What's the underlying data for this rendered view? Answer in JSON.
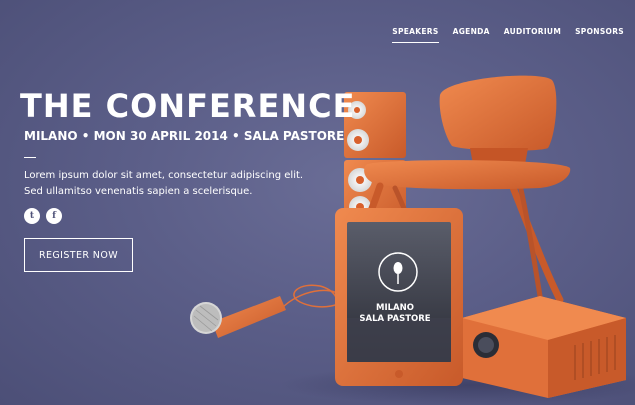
{
  "nav": {
    "items": [
      {
        "label": "SPEAKERS",
        "active": true
      },
      {
        "label": "AGENDA",
        "active": false
      },
      {
        "label": "AUDITORIUM",
        "active": false
      },
      {
        "label": "SPONSORS",
        "active": false
      }
    ]
  },
  "hero": {
    "title": "THE CONFERENCE",
    "subtitle": "MILANO • MON 30 APRIL 2014 • SALA PASTORE",
    "description": "Lorem ipsum dolor sit amet, consectetur adipiscing elit. Sed ullamitso venenatis sapien a scelerisque.",
    "register_label": "REGISTER NOW"
  },
  "social": {
    "twitter_icon": "twitter-icon",
    "facebook_icon": "facebook-icon"
  },
  "tablet": {
    "line1": "MILANO",
    "line2": "SALA PASTORE"
  },
  "colors": {
    "background": "#5b5e88",
    "accent_orange": "#e0703a",
    "text": "#ffffff"
  }
}
